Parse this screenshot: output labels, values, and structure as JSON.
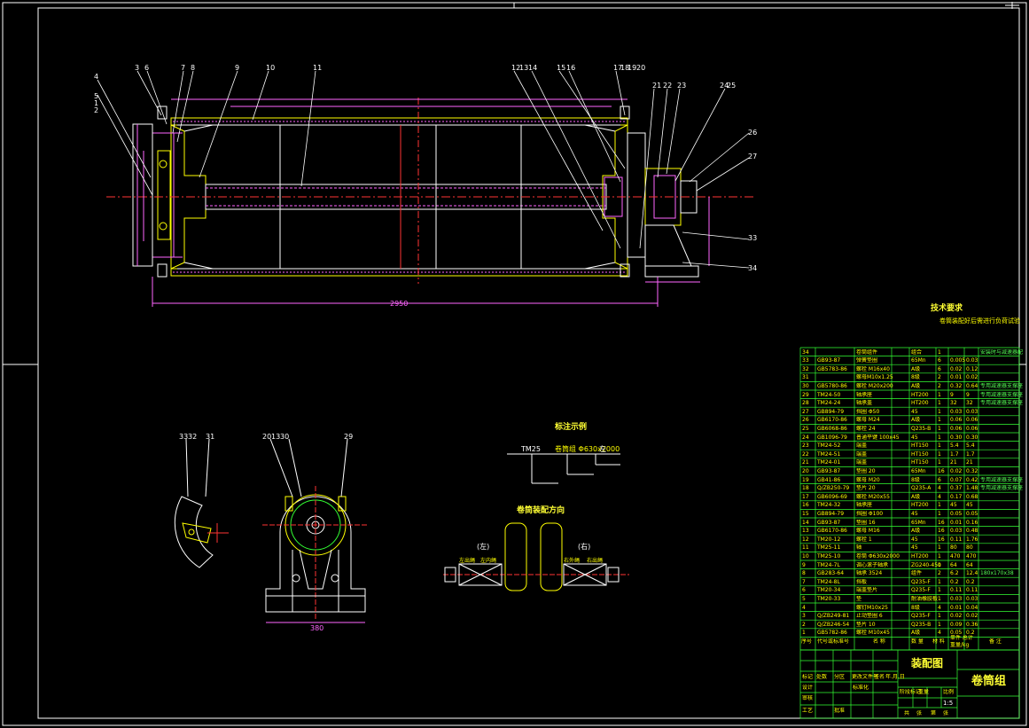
{
  "colors": {
    "background": "#000000",
    "border": "#ffffff",
    "outline": "#ffff00",
    "section": "#ff66ff",
    "center_line": "#ff3333",
    "table": "#33ff33",
    "dimension": "#ff66ff"
  },
  "main_view": {
    "part_callouts": [
      "3",
      "6",
      "7",
      "8",
      "9",
      "10",
      "11",
      "12",
      "13",
      "14",
      "15",
      "16",
      "17",
      "18",
      "19",
      "20",
      "21",
      "22",
      "23",
      "24",
      "25",
      "26",
      "27",
      "4",
      "5",
      "1",
      "2",
      "33",
      "34"
    ],
    "overall_length": "2950"
  },
  "notes": {
    "title": "技术要求",
    "line1": "卷筒装配好后需进行负荷试验"
  },
  "labels": {
    "marking_title": "标注示例",
    "marking_code": "TM25",
    "marking_spec": "卷筒组 Φ630x2000",
    "marking_tag": "左",
    "drum_direction_title": "卷筒装配方向",
    "left_label": "(左)",
    "right_label": "(右)",
    "left_side": "左出绳",
    "left_side2": "左内绳",
    "right_side": "右外绳",
    "right_side2": "右出绳",
    "bearing_callouts": [
      "20",
      "13",
      "30",
      "29"
    ],
    "clamp_callouts": [
      "33",
      "32",
      "31"
    ],
    "bearing_width": "380"
  },
  "bom": {
    "rows": [
      {
        "no": "34",
        "code": "",
        "name": "卷筒组件",
        "qty": "",
        "mat": "组合",
        "unit": "1",
        "w1": "",
        "w2": "",
        "remark": "安装时与减速器配"
      },
      {
        "no": "33",
        "code": "GB93-87",
        "name": "弹簧垫圈",
        "qty": "",
        "mat": "65Mn",
        "unit": "6",
        "w1": "0.005",
        "w2": "0.03",
        "remark": ""
      },
      {
        "no": "32",
        "code": "GB5783-86",
        "name": "螺栓 M16x40",
        "qty": "",
        "mat": "A级",
        "unit": "6",
        "w1": "0.02",
        "w2": "0.12",
        "remark": ""
      },
      {
        "no": "31",
        "code": "",
        "name": "螺母M10x1.25",
        "qty": "",
        "mat": "8级",
        "unit": "2",
        "w1": "0.01",
        "w2": "0.02",
        "remark": ""
      },
      {
        "no": "30",
        "code": "GB5780-86",
        "name": "螺栓 M20x200",
        "qty": "",
        "mat": "A级",
        "unit": "2",
        "w1": "0.32",
        "w2": "0.64",
        "remark": "专用减速器支撑座"
      },
      {
        "no": "29",
        "code": "TM24-50",
        "name": "轴承座",
        "qty": "",
        "mat": "HT200",
        "unit": "1",
        "w1": "9",
        "w2": "9",
        "remark": "专用减速器支撑座"
      },
      {
        "no": "28",
        "code": "TM24-24",
        "name": "轴承盖",
        "qty": "",
        "mat": "HT200",
        "unit": "1",
        "w1": "32",
        "w2": "32",
        "remark": "专用减速器支撑座"
      },
      {
        "no": "27",
        "code": "GB894-79",
        "name": "挡圈 Φ50",
        "qty": "",
        "mat": "45",
        "unit": "1",
        "w1": "0.03",
        "w2": "0.03",
        "remark": ""
      },
      {
        "no": "26",
        "code": "GB6170-86",
        "name": "螺母 M24",
        "qty": "",
        "mat": "A级",
        "unit": "1",
        "w1": "0.06",
        "w2": "0.06",
        "remark": ""
      },
      {
        "no": "25",
        "code": "GB6068-86",
        "name": "螺栓 24",
        "qty": "",
        "mat": "Q235-B",
        "unit": "1",
        "w1": "0.06",
        "w2": "0.06",
        "remark": ""
      },
      {
        "no": "24",
        "code": "GB1096-79",
        "name": "普通平键 100x45",
        "qty": "",
        "mat": "45",
        "unit": "1",
        "w1": "0.30",
        "w2": "0.30",
        "remark": ""
      },
      {
        "no": "23",
        "code": "TM24-52",
        "name": "端盖",
        "qty": "",
        "mat": "HT150",
        "unit": "1",
        "w1": "5.4",
        "w2": "5.4",
        "remark": ""
      },
      {
        "no": "22",
        "code": "TM24-51",
        "name": "端盖",
        "qty": "",
        "mat": "HT150",
        "unit": "1",
        "w1": "1.7",
        "w2": "1.7",
        "remark": ""
      },
      {
        "no": "21",
        "code": "TM24-01",
        "name": "端盖",
        "qty": "",
        "mat": "HT150",
        "unit": "1",
        "w1": "21",
        "w2": "21",
        "remark": ""
      },
      {
        "no": "20",
        "code": "GB93-87",
        "name": "垫圈 20",
        "qty": "",
        "mat": "65Mn",
        "unit": "16",
        "w1": "0.02",
        "w2": "0.32",
        "remark": ""
      },
      {
        "no": "19",
        "code": "GB41-86",
        "name": "螺母 M20",
        "qty": "",
        "mat": "8级",
        "unit": "6",
        "w1": "0.07",
        "w2": "0.42",
        "remark": "专用减速器支撑座"
      },
      {
        "no": "18",
        "code": "Q/ZB250-79",
        "name": "垫片 20",
        "qty": "",
        "mat": "Q235-A",
        "unit": "4",
        "w1": "0.37",
        "w2": "1.48",
        "remark": "专用减速器支撑座"
      },
      {
        "no": "17",
        "code": "GB6096-69",
        "name": "螺栓 M20x55",
        "qty": "",
        "mat": "A级",
        "unit": "4",
        "w1": "0.17",
        "w2": "0.68",
        "remark": ""
      },
      {
        "no": "16",
        "code": "TM24-32",
        "name": "轴承座",
        "qty": "",
        "mat": "HT200",
        "unit": "1",
        "w1": "45",
        "w2": "45",
        "remark": ""
      },
      {
        "no": "15",
        "code": "GB894-79",
        "name": "挡圈 Φ100",
        "qty": "",
        "mat": "45",
        "unit": "1",
        "w1": "0.05",
        "w2": "0.05",
        "remark": ""
      },
      {
        "no": "14",
        "code": "GB93-87",
        "name": "垫圈 16",
        "qty": "",
        "mat": "65Mn",
        "unit": "16",
        "w1": "0.01",
        "w2": "0.16",
        "remark": ""
      },
      {
        "no": "13",
        "code": "GB6170-86",
        "name": "螺母 M16",
        "qty": "",
        "mat": "A级",
        "unit": "16",
        "w1": "0.03",
        "w2": "0.48",
        "remark": ""
      },
      {
        "no": "12",
        "code": "TM20-12",
        "name": "螺栓 1",
        "qty": "",
        "mat": "45",
        "unit": "16",
        "w1": "0.11",
        "w2": "1.76",
        "remark": ""
      },
      {
        "no": "11",
        "code": "TM25-11",
        "name": "轴",
        "qty": "",
        "mat": "45",
        "unit": "1",
        "w1": "80",
        "w2": "80",
        "remark": ""
      },
      {
        "no": "10",
        "code": "TM25-10",
        "name": "卷筒 Φ630x2000",
        "qty": "",
        "mat": "HT200",
        "unit": "1",
        "w1": "470",
        "w2": "470",
        "remark": ""
      },
      {
        "no": "9",
        "code": "TM24-7L",
        "name": "调心滚子轴承",
        "qty": "",
        "mat": "ZG240-450",
        "unit": "1",
        "w1": "64",
        "w2": "64",
        "remark": ""
      },
      {
        "no": "8",
        "code": "GB283-64",
        "name": "轴承 3524",
        "qty": "",
        "mat": "组件",
        "unit": "2",
        "w1": "6.2",
        "w2": "12.4",
        "remark": "180x170x38"
      },
      {
        "no": "7",
        "code": "TM24-8L",
        "name": "挡板",
        "qty": "",
        "mat": "Q235-F",
        "unit": "1",
        "w1": "0.2",
        "w2": "0.2",
        "remark": ""
      },
      {
        "no": "6",
        "code": "TM20-34",
        "name": "端盖垫片",
        "qty": "",
        "mat": "Q235-F",
        "unit": "1",
        "w1": "0.11",
        "w2": "0.11",
        "remark": ""
      },
      {
        "no": "5",
        "code": "TM20-33",
        "name": "垫",
        "qty": "",
        "mat": "耐油橡胶板",
        "unit": "1",
        "w1": "0.03",
        "w2": "0.03",
        "remark": ""
      },
      {
        "no": "4",
        "code": "",
        "name": "螺钉M10x25",
        "qty": "",
        "mat": "8级",
        "unit": "4",
        "w1": "0.01",
        "w2": "0.04",
        "remark": ""
      },
      {
        "no": "3",
        "code": "Q/ZB249-81",
        "name": "止动垫圈 6",
        "qty": "",
        "mat": "Q235-F",
        "unit": "1",
        "w1": "0.02",
        "w2": "0.02",
        "remark": ""
      },
      {
        "no": "2",
        "code": "Q/ZB246-54",
        "name": "垫片 10",
        "qty": "",
        "mat": "Q235-B",
        "unit": "1",
        "w1": "0.09",
        "w2": "0.36",
        "remark": ""
      },
      {
        "no": "1",
        "code": "GB5782-86",
        "name": "螺栓 M10x45",
        "qty": "",
        "mat": "A级",
        "unit": "4",
        "w1": "0.05",
        "w2": "0.2",
        "remark": ""
      }
    ],
    "header": {
      "no": "序号",
      "code": "代号或标准号",
      "name": "名 称",
      "qty": "数 量",
      "mat": "材 料",
      "weight": "单件 总计",
      "weight_unit": "重量/kg",
      "remark": "备 注"
    }
  },
  "title_block": {
    "drawing_type": "装配图",
    "assembly_name": "卷筒组",
    "scale": "1:5",
    "row_labels": [
      "标记",
      "处数",
      "分区",
      "更改文件号",
      "签名",
      "年.月.日"
    ],
    "roles": [
      "设计",
      "审核",
      "工艺",
      "批准"
    ],
    "stage_labels": [
      "阶段标记",
      "重量",
      "比例"
    ],
    "sheet_labels": [
      "共",
      "张",
      "第",
      "张"
    ],
    "std_label": "标准化"
  }
}
